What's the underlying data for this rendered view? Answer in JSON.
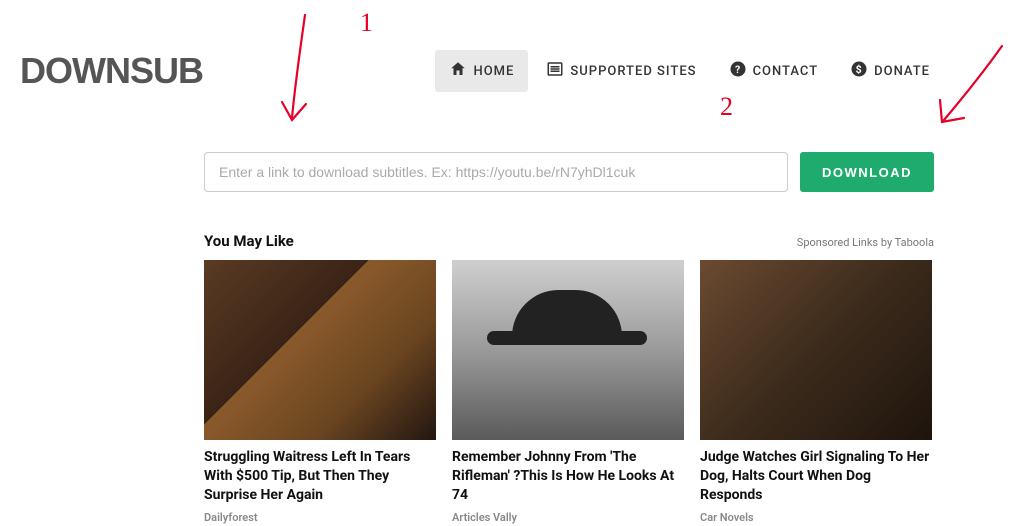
{
  "brand": "DOWNSUB",
  "nav": {
    "home": "HOME",
    "supported": "SUPPORTED SITES",
    "contact": "CONTACT",
    "donate": "DONATE"
  },
  "search": {
    "placeholder": "Enter a link to download subtitles. Ex: https://youtu.be/rN7yhDl1cuk",
    "button": "DOWNLOAD"
  },
  "ads": {
    "heading": "You May Like",
    "sponsor": "Sponsored Links by Taboola",
    "cards": [
      {
        "title": "Struggling Waitress Left In Tears With $500 Tip, But Then They Surprise Her Again",
        "source": "Dailyforest"
      },
      {
        "title": "Remember Johnny From 'The Rifleman' ?This Is How He Looks At 74",
        "source": "Articles Vally"
      },
      {
        "title": "Judge Watches Girl Signaling To Her Dog, Halts Court When Dog Responds",
        "source": "Car Novels"
      }
    ]
  },
  "annotations": {
    "one": "1",
    "two": "2"
  }
}
